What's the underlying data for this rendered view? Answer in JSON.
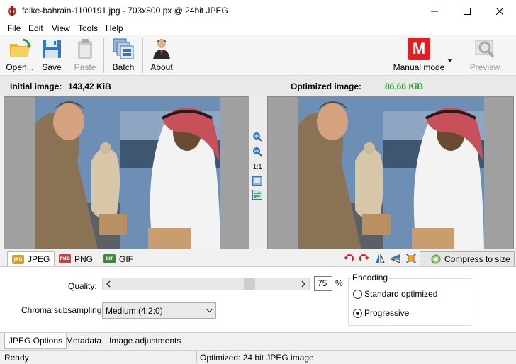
{
  "window": {
    "title": "falke-bahrain-1100191.jpg - 703x800 px @ 24bit JPEG"
  },
  "menu": [
    "File",
    "Edit",
    "View",
    "Tools",
    "Help"
  ],
  "toolbar": {
    "open": "Open...",
    "save": "Save",
    "paste": "Paste",
    "batch": "Batch",
    "about": "About",
    "mode": "Manual mode",
    "mode_letter": "M",
    "preview": "Preview"
  },
  "sizes": {
    "initial_label": "Initial image:",
    "initial_value": "143,42 KiB",
    "optimized_label": "Optimized image:",
    "optimized_value": "86,66 KiB",
    "optimized_color": "#2a9d2a"
  },
  "zoom": {
    "ratio": "1:1"
  },
  "formats": [
    "JPEG",
    "PNG",
    "GIF"
  ],
  "compress_button": "Compress to size",
  "options": {
    "quality_label": "Quality:",
    "quality_value": "75",
    "quality_unit": "%",
    "chroma_label": "Chroma subsampling:",
    "chroma_value": "Medium (4:2:0)",
    "encoding_title": "Encoding",
    "encoding_options": [
      "Standard optimized",
      "Progressive"
    ],
    "encoding_selected": "Progressive"
  },
  "bottom_tabs": [
    "JPEG Options",
    "Metadata",
    "Image adjustments"
  ],
  "status": {
    "left": "Ready",
    "right": "Optimized: 24 bit JPEG image"
  },
  "colors": {
    "accent_red": "#e02020",
    "status_green": "#2a9d2a"
  }
}
